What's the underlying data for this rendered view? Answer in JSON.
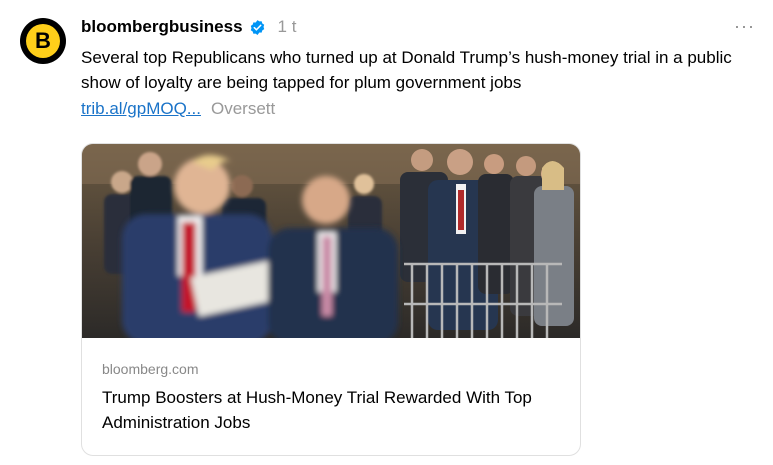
{
  "post": {
    "username": "bloombergbusiness",
    "avatar_letter": "B",
    "timestamp": "1 t",
    "more_label": "···",
    "text": "Several top Republicans who turned up at Donald Trump’s hush-money trial in a public show of loyalty are being tapped for plum government jobs",
    "link_text": "trib.al/gpMOQ...",
    "translate_label": "Oversett"
  },
  "card": {
    "domain": "bloomberg.com",
    "title": "Trump Boosters at Hush-Money Trial Rewarded With Top Administration Jobs"
  },
  "colors": {
    "brand_yellow": "#ffcf1a",
    "verified_blue": "#0095f6",
    "link_blue": "#1a73c8",
    "muted_gray": "#999999"
  },
  "icons": {
    "verified": "verified-badge-icon",
    "more": "more-options-icon"
  }
}
